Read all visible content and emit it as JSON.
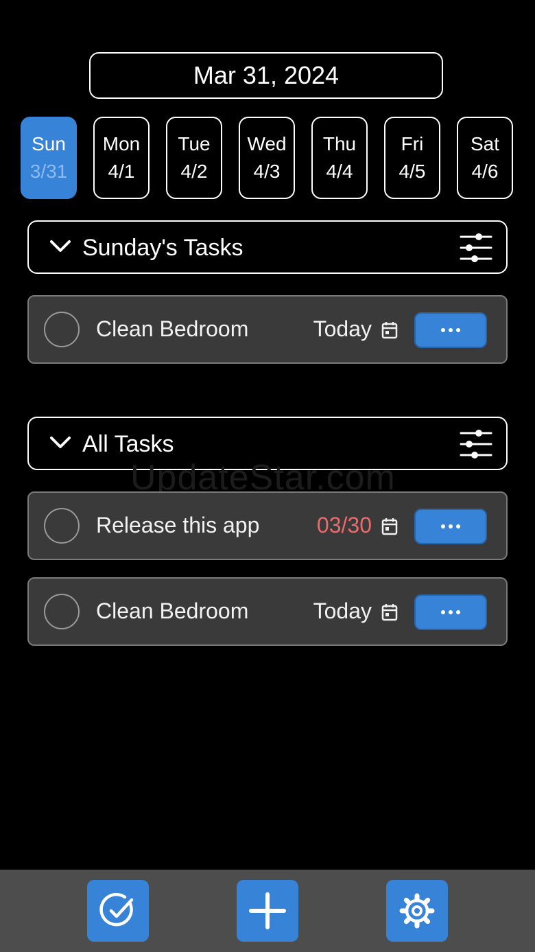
{
  "header": {
    "date": "Mar 31, 2024"
  },
  "week": [
    {
      "day": "Sun",
      "date": "3/31",
      "selected": true
    },
    {
      "day": "Mon",
      "date": "4/1"
    },
    {
      "day": "Tue",
      "date": "4/2"
    },
    {
      "day": "Wed",
      "date": "4/3"
    },
    {
      "day": "Thu",
      "date": "4/4"
    },
    {
      "day": "Fri",
      "date": "4/5"
    },
    {
      "day": "Sat",
      "date": "4/6"
    }
  ],
  "sections": [
    {
      "title": "Sunday's Tasks",
      "tasks": [
        {
          "title": "Clean Bedroom",
          "due": "Today",
          "overdue": false
        }
      ]
    },
    {
      "title": "All Tasks",
      "tasks": [
        {
          "title": "Release this app",
          "due": "03/30",
          "overdue": true
        },
        {
          "title": "Clean Bedroom",
          "due": "Today",
          "overdue": false
        }
      ]
    }
  ],
  "watermark": "UpdateStar.com",
  "tabbar": {
    "icons": [
      "check-circle-icon",
      "plus-icon",
      "gear-icon"
    ]
  },
  "colors": {
    "accent": "#3783d8",
    "overdue": "#ee6a6a",
    "card": "#3a3a3a",
    "tabbar": "#4d4d4d"
  }
}
